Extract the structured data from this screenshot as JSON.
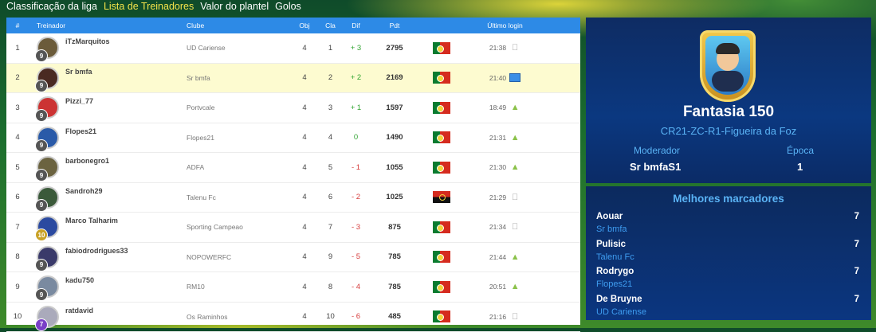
{
  "tabs": [
    "Classificação da liga",
    "Lista de Treinadores",
    "Valor do plantel",
    "Golos"
  ],
  "table": {
    "headers": {
      "num": "#",
      "coach": "Treinador",
      "club": "Clube",
      "obj": "Obj",
      "cla": "Cla",
      "dif": "Dif",
      "pdt": "Pdt",
      "login": "Último login"
    },
    "rows": [
      {
        "num": "1",
        "coach": "iTzMarquitos",
        "level": "9",
        "club": "UD Cariense",
        "obj": "4",
        "cla": "1",
        "dif": "+ 3",
        "pdt": "2795",
        "flag": "pt",
        "time": "21:38",
        "os": "apple"
      },
      {
        "num": "2",
        "coach": "Sr bmfa",
        "level": "9",
        "club": "Sr bmfa",
        "obj": "4",
        "cla": "2",
        "dif": "+ 2",
        "pdt": "2169",
        "flag": "pt",
        "time": "21:40",
        "os": "desktop"
      },
      {
        "num": "3",
        "coach": "Pizzi_77",
        "level": "9",
        "club": "Portvcale",
        "obj": "4",
        "cla": "3",
        "dif": "+ 1",
        "pdt": "1597",
        "flag": "pt",
        "time": "18:49",
        "os": "android"
      },
      {
        "num": "4",
        "coach": "Flopes21",
        "level": "9",
        "club": "Flopes21",
        "obj": "4",
        "cla": "4",
        "dif": "0",
        "pdt": "1490",
        "flag": "pt",
        "time": "21:31",
        "os": "android"
      },
      {
        "num": "5",
        "coach": "barbonegro1",
        "level": "9",
        "club": "ADFA",
        "obj": "4",
        "cla": "5",
        "dif": "- 1",
        "pdt": "1055",
        "flag": "pt",
        "time": "21:30",
        "os": "android"
      },
      {
        "num": "6",
        "coach": "Sandroh29",
        "level": "9",
        "club": "Talenu Fc",
        "obj": "4",
        "cla": "6",
        "dif": "- 2",
        "pdt": "1025",
        "flag": "ao",
        "time": "21:29",
        "os": "apple"
      },
      {
        "num": "7",
        "coach": "Marco Talharim",
        "level": "10",
        "club": "Sporting Campeao",
        "obj": "4",
        "cla": "7",
        "dif": "- 3",
        "pdt": "875",
        "flag": "pt",
        "time": "21:34",
        "os": "apple"
      },
      {
        "num": "8",
        "coach": "fabiodrodrigues33",
        "level": "9",
        "club": "NOPOWERFC",
        "obj": "4",
        "cla": "9",
        "dif": "- 5",
        "pdt": "785",
        "flag": "pt",
        "time": "21:44",
        "os": "android"
      },
      {
        "num": "9",
        "coach": "kadu750",
        "level": "9",
        "club": "RM10",
        "obj": "4",
        "cla": "8",
        "dif": "- 4",
        "pdt": "785",
        "flag": "pt",
        "time": "20:51",
        "os": "android"
      },
      {
        "num": "10",
        "coach": "ratdavid",
        "level": "7",
        "club": "Os Raminhos",
        "obj": "4",
        "cla": "10",
        "dif": "- 6",
        "pdt": "485",
        "flag": "pt",
        "time": "21:16",
        "os": "apple"
      }
    ]
  },
  "league": {
    "name": "Fantasia 150",
    "region": "CR21-ZC-R1-Figueira da Foz",
    "moderator_label": "Moderador",
    "moderator": "Sr bmfaS1",
    "season_label": "Época",
    "season": "1"
  },
  "scorers": {
    "title": "Melhores marcadores",
    "items": [
      {
        "name": "Aouar",
        "club": "Sr bmfa",
        "goals": "7"
      },
      {
        "name": "Pulisic",
        "club": "Talenu Fc",
        "goals": "7"
      },
      {
        "name": "Rodrygo",
        "club": "Flopes21",
        "goals": "7"
      },
      {
        "name": "De Bruyne",
        "club": "UD Cariense",
        "goals": "7"
      }
    ]
  },
  "colors": {
    "accent": "#2d8ae6",
    "positive": "#33a533",
    "negative": "#d63c3c",
    "active_tab": "#f3e24a"
  }
}
